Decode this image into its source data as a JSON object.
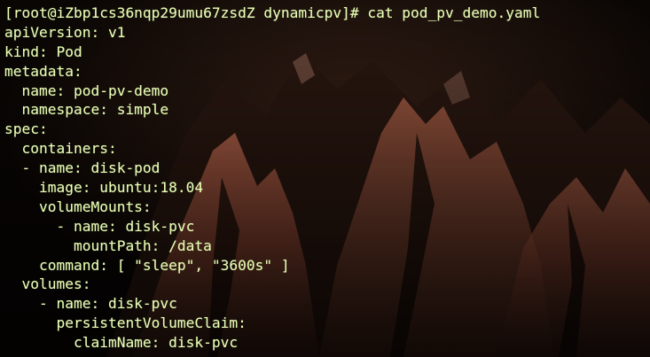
{
  "terminal": {
    "colors": {
      "text": "#e9ffb7",
      "background": "#0a0604",
      "wallpaper_light": "#b8614a",
      "wallpaper_dark": "#140d0a"
    },
    "lines": [
      "[root@iZbp1cs36nqp29umu67zsdZ dynamicpv]# cat pod_pv_demo.yaml",
      "apiVersion: v1",
      "kind: Pod",
      "metadata:",
      "  name: pod-pv-demo",
      "  namespace: simple",
      "spec:",
      "  containers:",
      "  - name: disk-pod",
      "    image: ubuntu:18.04",
      "    volumeMounts:",
      "      - name: disk-pvc",
      "        mountPath: /data",
      "    command: [ \"sleep\", \"3600s\" ]",
      "  volumes:",
      "    - name: disk-pvc",
      "      persistentVolumeClaim:",
      "        claimName: disk-pvc"
    ]
  }
}
